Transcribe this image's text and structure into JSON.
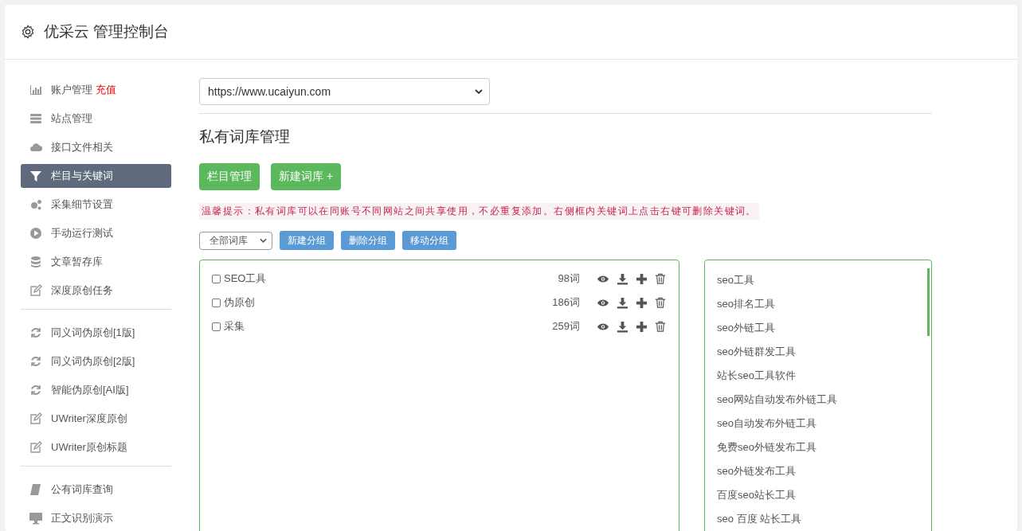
{
  "header": {
    "title": "优采云 管理控制台"
  },
  "sidebar": {
    "groups": [
      [
        {
          "label": "账户管理",
          "badge": "充值",
          "selected": false
        },
        {
          "label": "站点管理",
          "selected": false
        },
        {
          "label": "接口文件相关",
          "selected": false
        },
        {
          "label": "栏目与关键词",
          "selected": true
        },
        {
          "label": "采集细节设置",
          "selected": false
        },
        {
          "label": "手动运行测试",
          "selected": false
        },
        {
          "label": "文章暂存库",
          "selected": false
        },
        {
          "label": "深度原创任务",
          "selected": false
        }
      ],
      [
        {
          "label": "同义词伪原创[1版]",
          "selected": false
        },
        {
          "label": "同义词伪原创[2版]",
          "selected": false
        },
        {
          "label": "智能伪原创[AI版]",
          "selected": false
        },
        {
          "label": "UWriter深度原创",
          "selected": false
        },
        {
          "label": "UWriter原创标题",
          "selected": false
        }
      ],
      [
        {
          "label": "公有词库查询",
          "selected": false
        },
        {
          "label": "正文识别演示",
          "selected": false
        }
      ]
    ]
  },
  "site_select": {
    "value": "https://www.ucaiyun.com"
  },
  "page_title": "私有词库管理",
  "action_buttons": [
    "栏目管理",
    "新建词库 +"
  ],
  "hint": "温馨提示：私有词库可以在同账号不同网站之间共享使用，不必重复添加。右侧框内关键词上点击右键可删除关键词。",
  "group_select": {
    "value": "全部词库"
  },
  "group_buttons": [
    "新建分组",
    "删除分组",
    "移动分组"
  ],
  "libraries": [
    {
      "name": "SEO工具",
      "count": "98词",
      "checked": false
    },
    {
      "name": "伪原创",
      "count": "186词",
      "checked": false
    },
    {
      "name": "采集",
      "count": "259词",
      "checked": false
    }
  ],
  "keywords": [
    "seo工具",
    "seo排名工具",
    "seo外链工具",
    "seo外链群发工具",
    "站长seo工具软件",
    "seo网站自动发布外链工具",
    "seo自动发布外链工具",
    "免费seo外链发布工具",
    "seo外链发布工具",
    "百度seo站长工具",
    "seo 百度 站长工具"
  ]
}
